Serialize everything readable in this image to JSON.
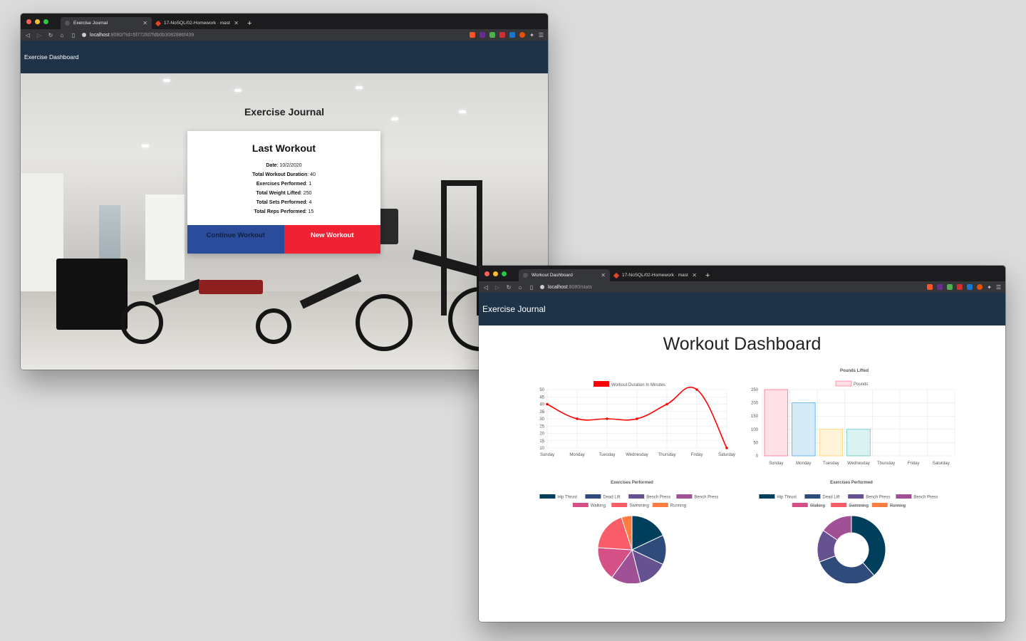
{
  "colors": {
    "red": "#ef2133",
    "blue": "#2b4c9b",
    "navbar": "#1f3348",
    "series": [
      "#003f5c",
      "#2f4b7c",
      "#665191",
      "#a05195",
      "#d45087",
      "#f95d6a",
      "#ff7c43",
      "#ffa600"
    ]
  },
  "window1": {
    "tabs": [
      {
        "title": "Exercise Journal",
        "active": true
      },
      {
        "title": "17-NoSQL/02-Homework · mast",
        "active": false
      }
    ],
    "url": {
      "host": "localhost",
      "path": ":8080/?id=5f772fd7fdb0b3082886f439"
    },
    "navbar_brand": "Exercise Dashboard",
    "page_title": "Exercise Journal",
    "card": {
      "title": "Last Workout",
      "stats": [
        {
          "label": "Date",
          "value": "10/2/2020"
        },
        {
          "label": "Total Workout Duration",
          "value": "40"
        },
        {
          "label": "Exercises Performed",
          "value": "1"
        },
        {
          "label": "Total Weight Lifted",
          "value": "250"
        },
        {
          "label": "Total Sets Performed",
          "value": "4"
        },
        {
          "label": "Total Reps Performed",
          "value": "15"
        }
      ],
      "continue_label": "Continue Workout",
      "new_label": "New Workout"
    }
  },
  "window2": {
    "tabs": [
      {
        "title": "Workout Dashboard",
        "active": true
      },
      {
        "title": "17-NoSQL/02-Homework · mast",
        "active": false
      }
    ],
    "url": {
      "host": "localhost",
      "path": ":8080/stats"
    },
    "navbar_brand": "Exercise Journal",
    "page_title": "Workout Dashboard"
  },
  "chart_data": [
    {
      "type": "line",
      "title": "",
      "categories": [
        "Sunday",
        "Monday",
        "Tuesday",
        "Wednesday",
        "Thursday",
        "Friday",
        "Saturday"
      ],
      "series": [
        {
          "name": "Workout Duration In Minutes",
          "values": [
            40,
            30,
            30,
            30,
            40,
            50,
            10
          ]
        }
      ],
      "ylim": [
        10,
        50
      ],
      "yticks": [
        10,
        15,
        20,
        25,
        30,
        35,
        40,
        45,
        50
      ],
      "grid": true,
      "legend": "top"
    },
    {
      "type": "bar",
      "title": "Pounds Lifted",
      "categories": [
        "Sunday",
        "Monday",
        "Tuesday",
        "Wednesday",
        "Thursday",
        "Friday",
        "Saturday"
      ],
      "series": [
        {
          "name": "Pounds",
          "values": [
            250,
            200,
            100,
            100,
            0,
            0,
            0
          ]
        }
      ],
      "ylim": [
        0,
        250
      ],
      "yticks": [
        0,
        50,
        100,
        150,
        200,
        250
      ],
      "grid": true,
      "legend": "top"
    },
    {
      "type": "pie",
      "title": "Exercises Performed",
      "labels": [
        "Hip Thrust",
        "Dead Lift",
        "Bench Press",
        "Bench Press",
        "Walking",
        "Swimming",
        "Running"
      ],
      "values": [
        18,
        14,
        14,
        14,
        16,
        19,
        5
      ],
      "legend": "top"
    },
    {
      "type": "donut",
      "title": "Exercises Performed",
      "labels": [
        "Hip Thrust",
        "Dead Lift",
        "Bench Press",
        "Bench Press",
        "Walking",
        "Swimming",
        "Running"
      ],
      "values": [
        250,
        200,
        100,
        100,
        0,
        0,
        0
      ],
      "hidden": [
        "Walking",
        "Swimming",
        "Running"
      ],
      "legend": "top"
    }
  ]
}
